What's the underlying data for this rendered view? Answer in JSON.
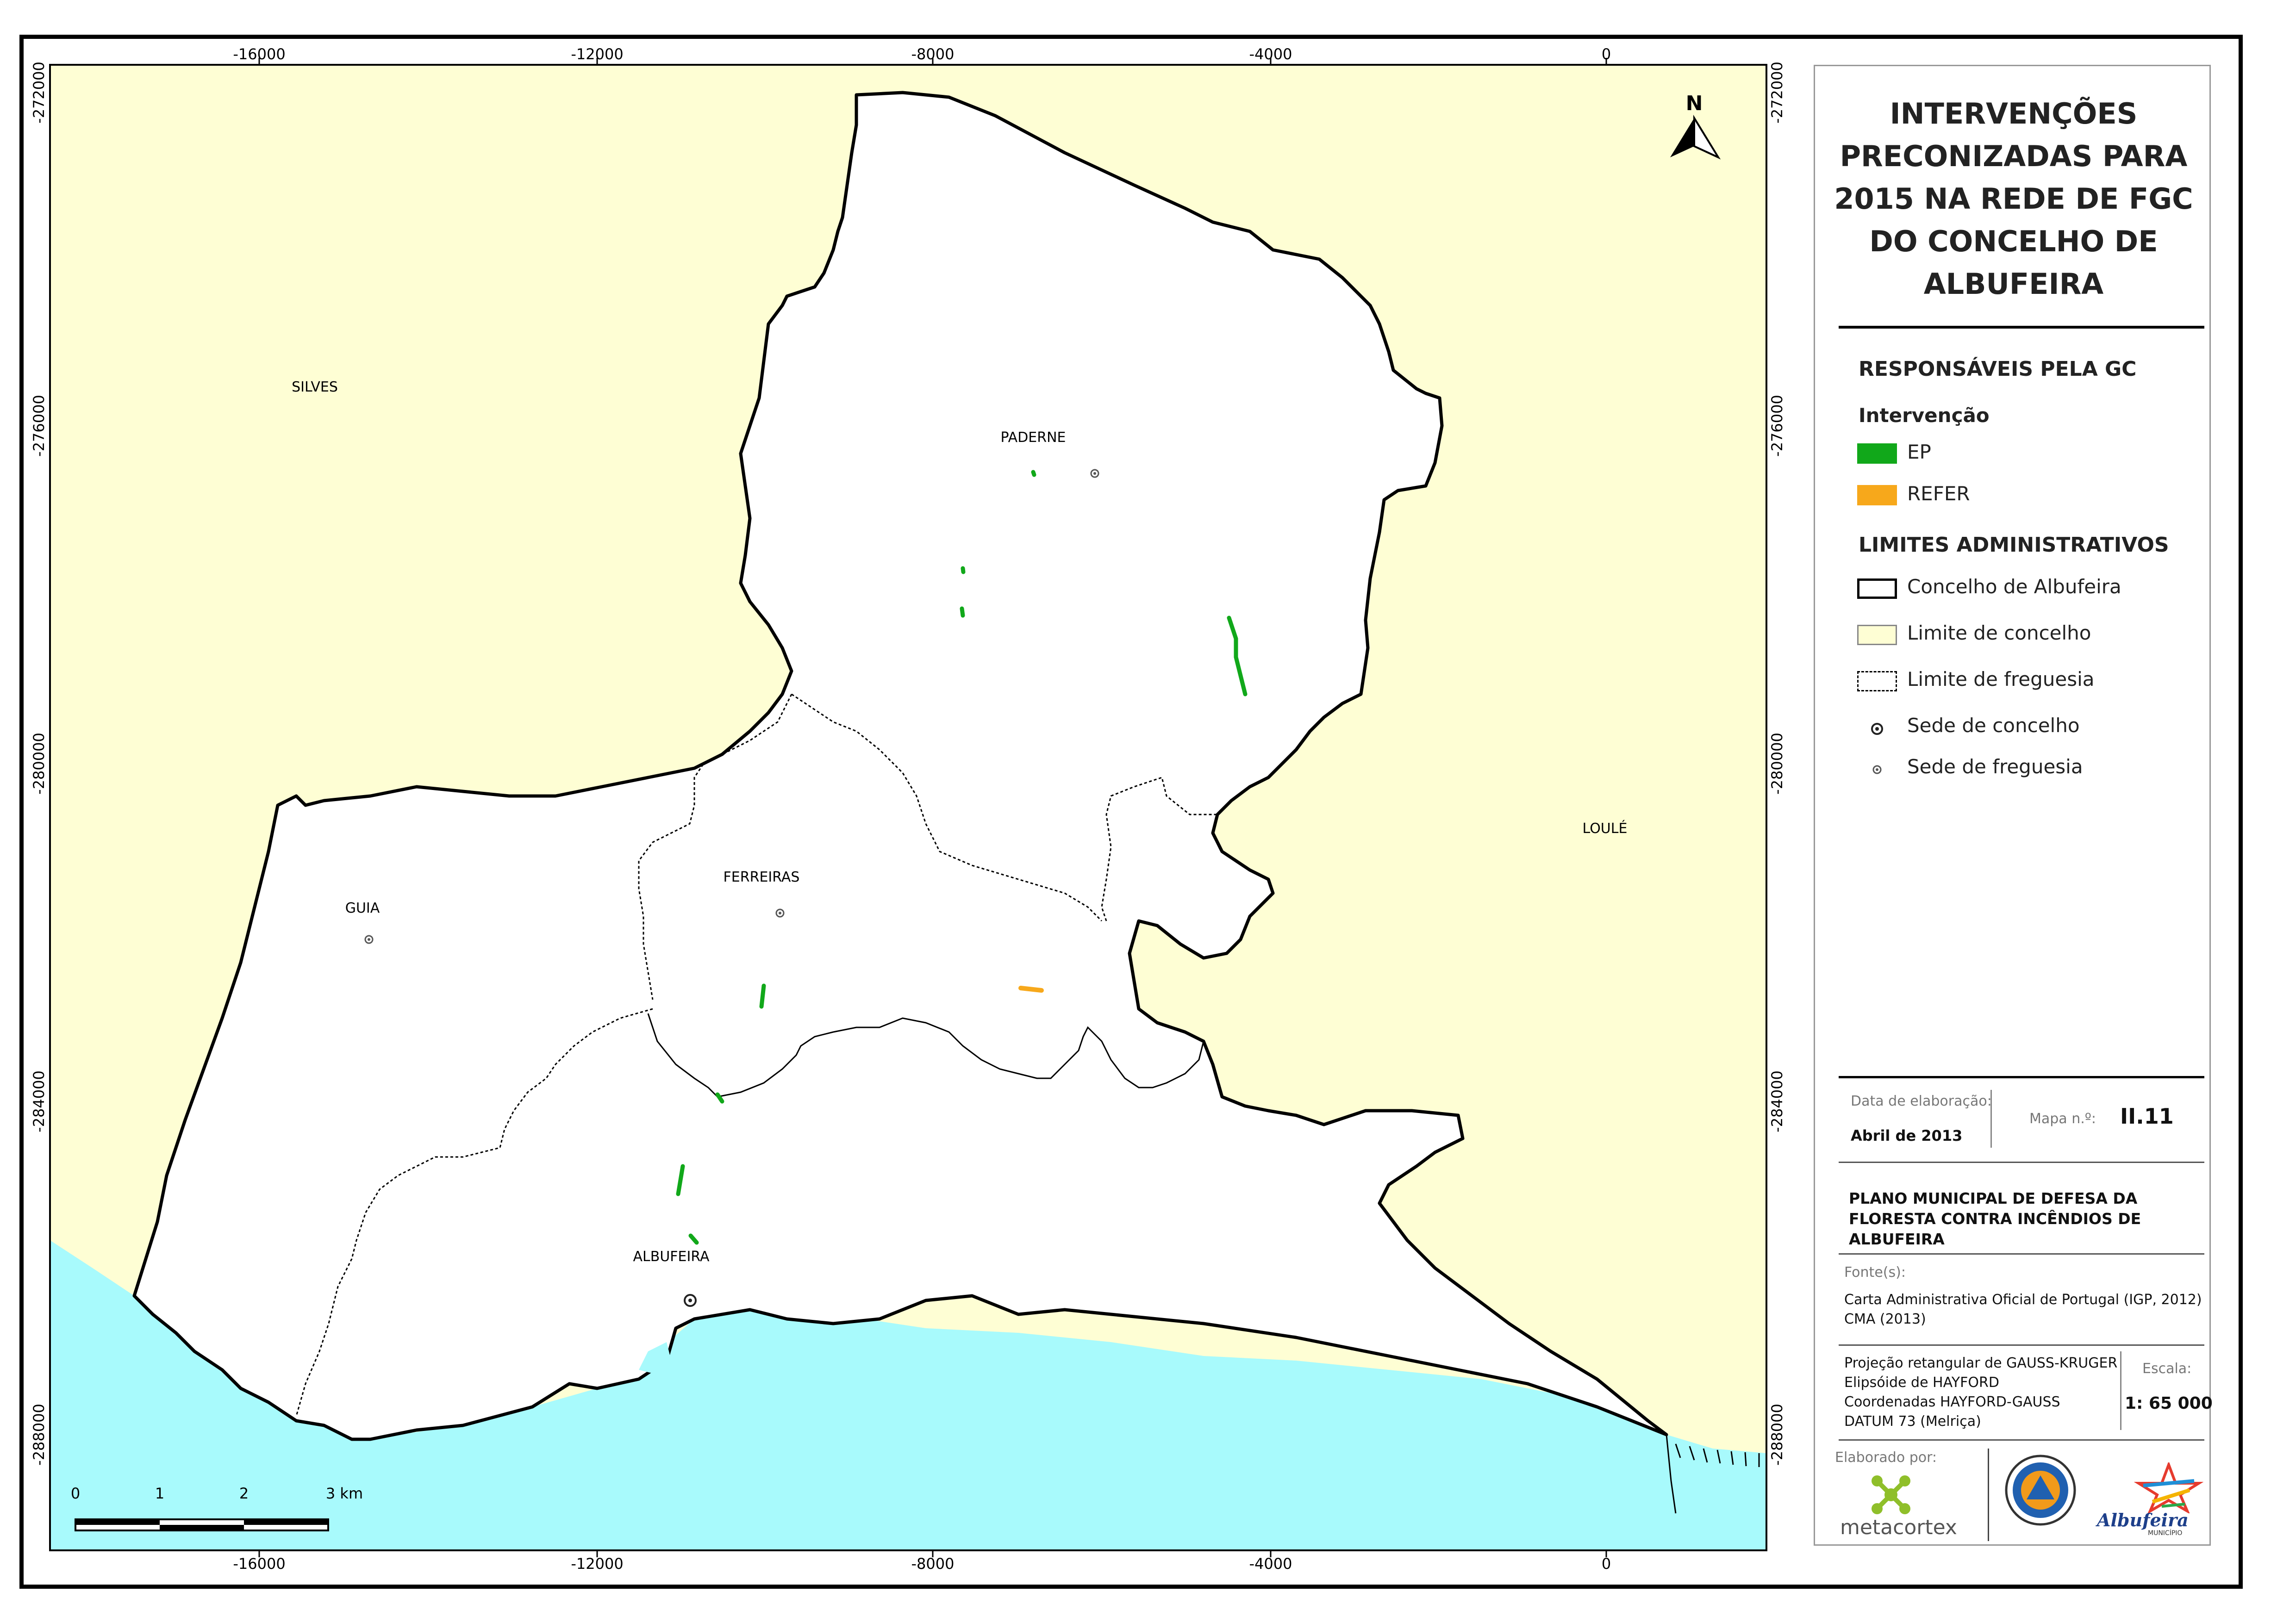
{
  "title": "INTERVENÇÕES PRECONIZADAS PARA 2015 NA REDE DE FGC DO CONCELHO DE ALBUFEIRA",
  "legend": {
    "section1": "RESPONSÁVEIS PELA GC",
    "group1": "Intervenção",
    "items1": [
      {
        "label": "EP",
        "color": "#11a81a"
      },
      {
        "label": "REFER",
        "color": "#f7a81b"
      }
    ],
    "section2": "LIMITES ADMINISTRATIVOS",
    "items2": [
      {
        "label": "Concelho de Albufeira"
      },
      {
        "label": "Limite de concelho",
        "color": "#fefed4"
      },
      {
        "label": "Limite de freguesia"
      },
      {
        "label": "Sede de concelho"
      },
      {
        "label": "Sede de freguesia"
      }
    ]
  },
  "info": {
    "date_label": "Data de elaboração:",
    "date_value": "Abril de 2013",
    "map_no_label": "Mapa n.º:",
    "map_no_value": "II.11",
    "plan": "PLANO MUNICIPAL DE DEFESA DA FLORESTA CONTRA INCÊNDIOS DE ALBUFEIRA",
    "sources_label": "Fonte(s):",
    "sources": [
      "Carta Administrativa Oficial de Portugal (IGP, 2012)",
      "CMA (2013)"
    ],
    "projection": [
      "Projeção retangular de GAUSS-KRUGER",
      "Elipsóide de HAYFORD",
      "Coordenadas HAYFORD-GAUSS",
      "DATUM 73 (Melriça)"
    ],
    "scale_label": "Escala:",
    "scale_value": "1: 65 000",
    "made_by": "Elaborado por:",
    "logos": [
      "metacortex",
      "Albufeira",
      "MUNICÍPIO"
    ]
  },
  "map": {
    "north": "N",
    "x_ticks": [
      "-16000",
      "-12000",
      "-8000",
      "-4000",
      "0"
    ],
    "y_ticks": [
      "-272000",
      "-276000",
      "-280000",
      "-284000",
      "-288000"
    ],
    "places": [
      "SILVES",
      "PADERNE",
      "LOULÉ",
      "GUIA",
      "FERREIRAS",
      "ALBUFEIRA"
    ],
    "scalebar": [
      "0",
      "1",
      "2",
      "3 km"
    ],
    "colors": {
      "neighbour": "#fefed4",
      "sea": "#a8fafc",
      "ep": "#11a81a",
      "refer": "#f7a81b"
    }
  }
}
